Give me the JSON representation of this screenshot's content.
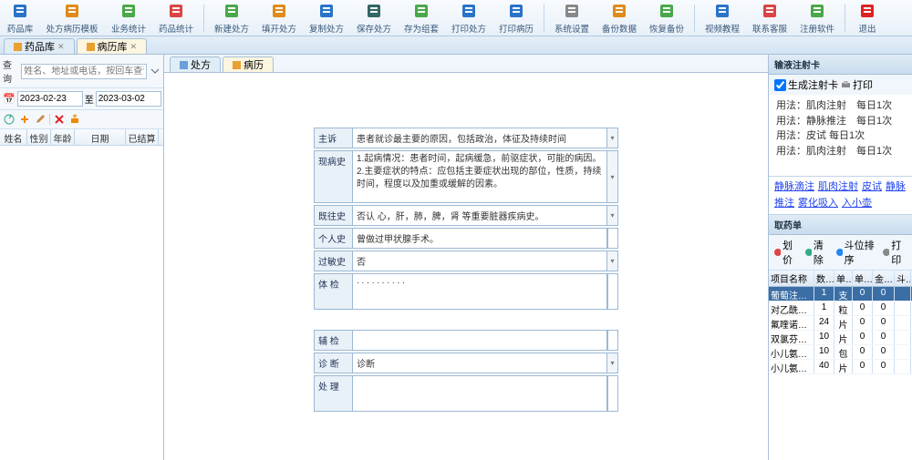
{
  "toolbar": [
    {
      "id": "drug-lib",
      "label": "药品库",
      "color": "#2a74c8"
    },
    {
      "id": "rx-template",
      "label": "处方病历模板",
      "color": "#e08a1a"
    },
    {
      "id": "biz-stats",
      "label": "业务统计",
      "color": "#4aa84a"
    },
    {
      "id": "drug-stats",
      "label": "药品统计",
      "color": "#d44"
    },
    {
      "sep": true
    },
    {
      "id": "new-rx",
      "label": "新建处方",
      "color": "#4aa84a"
    },
    {
      "id": "open-rx",
      "label": "填开处方",
      "color": "#e08a1a"
    },
    {
      "id": "copy-rx",
      "label": "复制处方",
      "color": "#2a74c8"
    },
    {
      "id": "save-rx",
      "label": "保存处方",
      "color": "#366"
    },
    {
      "id": "save-visit",
      "label": "存为组套",
      "color": "#4aa84a"
    },
    {
      "id": "print-rx",
      "label": "打印处方",
      "color": "#2a74c8"
    },
    {
      "id": "print-history",
      "label": "打印病历",
      "color": "#2a74c8"
    },
    {
      "sep": true
    },
    {
      "id": "sys-settings",
      "label": "系统设置",
      "color": "#888"
    },
    {
      "id": "backup",
      "label": "备份数据",
      "color": "#e08a1a"
    },
    {
      "id": "restore",
      "label": "恢复备份",
      "color": "#4aa84a"
    },
    {
      "sep": true
    },
    {
      "id": "video",
      "label": "视频教程",
      "color": "#2a74c8"
    },
    {
      "id": "contact",
      "label": "联系客服",
      "color": "#d44"
    },
    {
      "id": "register",
      "label": "注册软件",
      "color": "#4aa84a"
    },
    {
      "sep": true
    },
    {
      "id": "exit",
      "label": "退出",
      "color": "#d22"
    }
  ],
  "page_tabs": [
    {
      "id": "drug-lib",
      "label": "药品库"
    },
    {
      "id": "history-lib",
      "label": "病历库",
      "active": true
    }
  ],
  "center_tabs": [
    {
      "id": "rx",
      "label": "处方"
    },
    {
      "id": "history",
      "label": "病历",
      "active": true
    }
  ],
  "search": {
    "label": "查询",
    "placeholder": "姓名、地址或电话，按回车查询"
  },
  "date": {
    "from": "2023-02-23",
    "to_lbl": "至",
    "to": "2023-03-02"
  },
  "list_headers": [
    "姓名",
    "性别",
    "年龄",
    "日期",
    "已结算"
  ],
  "form": {
    "rows": [
      {
        "k": "zhusu",
        "label": "主诉",
        "val": "患者就诊最主要的原因，包括政治，体征及持续时间",
        "dd": true
      },
      {
        "k": "xbs",
        "label": "现病史",
        "val": "1.起病情况：患者时间，起病缓急，前驱症状，可能的病因。\n2.主要症状的特点：应包括主要症状出现的部位，性质，持续时间，程度以及加重或缓解的因素。",
        "tall": true,
        "dd": true
      },
      {
        "k": "jws",
        "label": "既往史",
        "val": "否认 心，肝，肺，脾，肾 等重要脏器疾病史。",
        "dd": true
      },
      {
        "k": "grs",
        "label": "个人史",
        "val": "曾做过甲状腺手术。"
      },
      {
        "k": "gms",
        "label": "过敏史",
        "val": "否",
        "dd": true
      },
      {
        "k": "tj",
        "label": "体 检",
        "val": ". . . . . . . . . .",
        "tall2": true
      },
      {
        "k": "fj",
        "label": "辅 检",
        "val": ""
      },
      {
        "k": "zd",
        "label": "诊 断",
        "val": "诊断",
        "dd": true
      },
      {
        "k": "cl",
        "label": "处 理",
        "val": "",
        "tall2": true
      }
    ]
  },
  "inj_card": {
    "title": "输液注射卡",
    "gen": "生成注射卡",
    "print": "打印",
    "items": [
      {
        "t": "用法：肌肉注射　每日1次"
      },
      {
        "t": "用法：静脉推注　每日1次"
      },
      {
        "t": "用法：皮试 每日1次"
      },
      {
        "t": "用法：肌肉注射　每日1次"
      }
    ]
  },
  "links": [
    "静脉滴注",
    "肌肉注射",
    "皮试",
    "静脉推注",
    "雾化吸入",
    "入小壶"
  ],
  "med_panel": {
    "title": "取药单",
    "tb": [
      "划价",
      "清除",
      "斗位排序",
      "打印"
    ],
    "headers": [
      "项目名称",
      "数量",
      "单位",
      "单价",
      "金额",
      "斗位"
    ],
    "rows": [
      {
        "name": "葡萄注射液",
        "qty": "1",
        "unit": "支",
        "price": "0",
        "amt": "0",
        "bin": "",
        "sel": true
      },
      {
        "name": "对乙酰氨基...",
        "qty": "1",
        "unit": "粒",
        "price": "0",
        "amt": "0",
        "bin": ""
      },
      {
        "name": "氟喹诺酮片",
        "qty": "24",
        "unit": "片",
        "price": "0",
        "amt": "0",
        "bin": ""
      },
      {
        "name": "双氯芬酸钠...",
        "qty": "10",
        "unit": "片",
        "price": "0",
        "amt": "0",
        "bin": ""
      },
      {
        "name": "小儿氨酚黄...",
        "qty": "10",
        "unit": "包",
        "price": "0",
        "amt": "0",
        "bin": ""
      },
      {
        "name": "小儿氨酚黄...",
        "qty": "40",
        "unit": "片",
        "price": "0",
        "amt": "0",
        "bin": ""
      }
    ]
  }
}
